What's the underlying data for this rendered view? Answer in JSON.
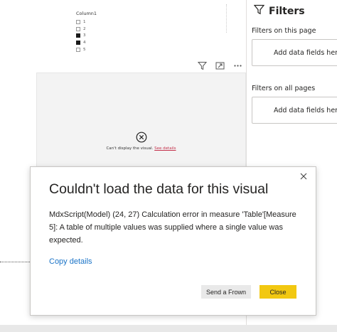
{
  "slicer": {
    "title": "Column1",
    "items": [
      {
        "label": "1",
        "checked": false
      },
      {
        "label": "2",
        "checked": false
      },
      {
        "label": "3",
        "checked": true
      },
      {
        "label": "4",
        "checked": true
      },
      {
        "label": "5",
        "checked": false
      }
    ]
  },
  "visual": {
    "error_message": "Can't display the visual.",
    "error_link": "See details"
  },
  "filters": {
    "title": "Filters",
    "on_this_page": "Filters on this page",
    "on_all_pages": "Filters on all pages",
    "add_fields_page": "Add data fields here",
    "add_fields_all": "Add data fields here"
  },
  "dialog": {
    "title": "Couldn't load the data for this visual",
    "body": "MdxScript(Model) (24, 27) Calculation error in measure 'Table'[Measure 5]: A table of multiple values was supplied where a single value was expected.",
    "copy_details": "Copy details",
    "frown_button": "Send a Frown",
    "close_button": "Close"
  },
  "colors": {
    "accent": "#f2c811",
    "link": "#1a73c7",
    "error_link": "#c4314b"
  },
  "icons": {
    "filter": "filter-icon",
    "focus": "focus-mode-icon",
    "more": "more-options-icon",
    "error": "error-circle-icon",
    "close": "close-icon"
  }
}
